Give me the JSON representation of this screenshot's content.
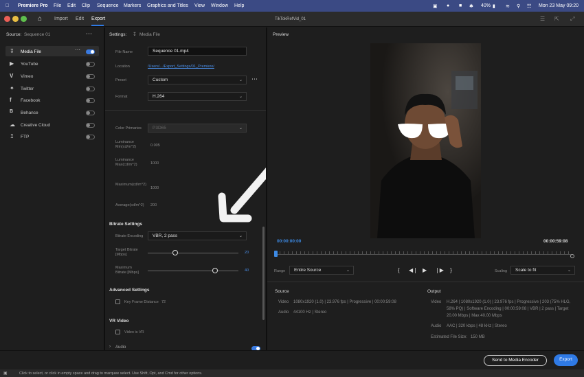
{
  "menubar": {
    "app": "Premiere Pro",
    "items": [
      "File",
      "Edit",
      "Clip",
      "Sequence",
      "Markers",
      "Graphics and Titles",
      "View",
      "Window",
      "Help"
    ],
    "battery": "40%",
    "datetime": "Mon 23 May  09:20"
  },
  "header": {
    "tabs": [
      "Import",
      "Edit",
      "Export"
    ],
    "active_tab": "Export",
    "title": "TikTokRefVid_01"
  },
  "source_panel": {
    "label": "Source:",
    "sequence": "Sequence 01",
    "destinations": [
      {
        "label": "Media File",
        "on": true
      },
      {
        "label": "YouTube",
        "on": false
      },
      {
        "label": "Vimeo",
        "on": false
      },
      {
        "label": "Twitter",
        "on": false
      },
      {
        "label": "Facebook",
        "on": false
      },
      {
        "label": "Behance",
        "on": false
      },
      {
        "label": "Creative Cloud",
        "on": false
      },
      {
        "label": "FTP",
        "on": false
      }
    ]
  },
  "settings": {
    "header": "Settings:",
    "header_target": "Media File",
    "file_name_label": "File Name",
    "file_name": "Sequence 01.mp4",
    "location_label": "Location",
    "location": "/Users/.../Export_Settings/01_Premiere/",
    "preset_label": "Preset",
    "preset": "Custom",
    "format_label": "Format",
    "format": "H.264",
    "color_primaries_label": "Color Primaries",
    "color_primaries": "P3D65",
    "lum_min_label": "Luminance Min(cd/m^2)",
    "lum_min": "0.005",
    "lum_max_label": "Luminance Max(cd/m^2)",
    "lum_max": "1000",
    "max_cll_label": "Maximum(cd/m^2)",
    "max_cll": "1000",
    "avg_label": "Average(cd/m^2)",
    "avg": "200",
    "bitrate_section": "Bitrate Settings",
    "bitrate_encoding_label": "Bitrate Encoding",
    "bitrate_encoding": "VBR, 2 pass",
    "target_bitrate_label": "Target Bitrate [Mbps]",
    "target_bitrate": "20",
    "target_bitrate_fraction": 0.3,
    "max_bitrate_label": "Maximum Bitrate [Mbps]",
    "max_bitrate": "40",
    "max_bitrate_fraction": 0.74,
    "advanced_section": "Advanced Settings",
    "key_frame_label": "Key Frame Distance",
    "key_frame_value": "72",
    "vr_section": "VR Video",
    "video_is_vr_label": "Video is VR",
    "audio_section": "Audio"
  },
  "preview": {
    "label": "Preview",
    "timecode_start": "00:00:00:00",
    "timecode_end": "00:00:59:08",
    "range_label": "Range",
    "range_value": "Entire Source",
    "scaling_label": "Scaling",
    "scaling_value": "Scale to fit"
  },
  "source_info": {
    "title": "Source",
    "video_label": "Video",
    "video_value": "1080x1920 (1.0)  |  23.976 fps  |  Progressive  |  00:00:59:08",
    "audio_label": "Audio",
    "audio_value": "44100 Hz  |  Stereo"
  },
  "output_info": {
    "title": "Output",
    "video_label": "Video",
    "video_line1": "H.264  |  1080x1920 (1.0)  |  23.976 fps  |  Progressive  |  203 (75% HLG,",
    "video_line2": "58% PQ)  |  Software Encoding  |  00:00:59:08  |  VBR  |  2 pass  |  Target",
    "video_line3": "20.00 Mbps  |  Max 40.00 Mbps",
    "audio_label": "Audio",
    "audio_value": "AAC  |  320 kbps  |  48 kHz  |  Stereo",
    "size_label": "Estimated File Size:",
    "size_value": "150 MB"
  },
  "footer": {
    "send_label": "Send to Media Encoder",
    "export_label": "Export",
    "status": "Click to select, or click in empty space and drag to marquee select. Use Shift, Opt, and Cmd for other options."
  },
  "colors": {
    "accent": "#2f7ae5",
    "menubar": "#3b4a84",
    "timecode": "#3d8be6"
  }
}
